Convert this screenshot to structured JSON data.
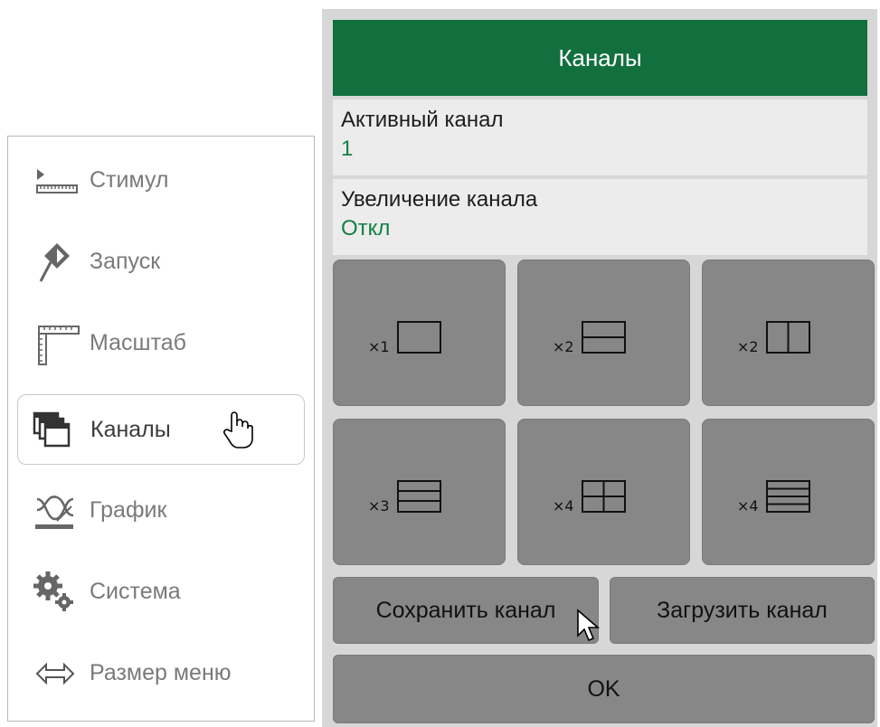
{
  "menu": {
    "items": [
      {
        "label": "Стимул",
        "icon": "stimulus-ruler-icon",
        "active": false
      },
      {
        "label": "Запуск",
        "icon": "trigger-diamond-icon",
        "active": false
      },
      {
        "label": "Масштаб",
        "icon": "scale-ruler-icon",
        "active": false
      },
      {
        "label": "Каналы",
        "icon": "channels-windows-icon",
        "active": true
      },
      {
        "label": "График",
        "icon": "trace-graph-icon",
        "active": false
      },
      {
        "label": "Система",
        "icon": "system-gears-icon",
        "active": false
      },
      {
        "label": "Размер меню",
        "icon": "double-arrow-icon",
        "active": false
      }
    ]
  },
  "panel": {
    "title": "Каналы",
    "active_channel": {
      "label": "Активный канал",
      "value": "1"
    },
    "channel_zoom": {
      "label": "Увеличение канала",
      "value": "Откл"
    },
    "layouts": [
      {
        "multiplier": "×1",
        "icon": "layout-1-icon"
      },
      {
        "multiplier": "×2",
        "icon": "layout-2-horizontal-icon"
      },
      {
        "multiplier": "×2",
        "icon": "layout-2-vertical-icon"
      },
      {
        "multiplier": "×3",
        "icon": "layout-3-horizontal-icon"
      },
      {
        "multiplier": "×4",
        "icon": "layout-4-grid-icon"
      },
      {
        "multiplier": "×4",
        "icon": "layout-4-horizontal-icon"
      }
    ],
    "save_label": "Сохранить канал",
    "load_label": "Загрузить канал",
    "ok_label": "OK"
  },
  "colors": {
    "title_bar": "#12703e",
    "value_text": "#138043",
    "panel_bg": "#d7d7d7",
    "button_bg": "#878787"
  }
}
